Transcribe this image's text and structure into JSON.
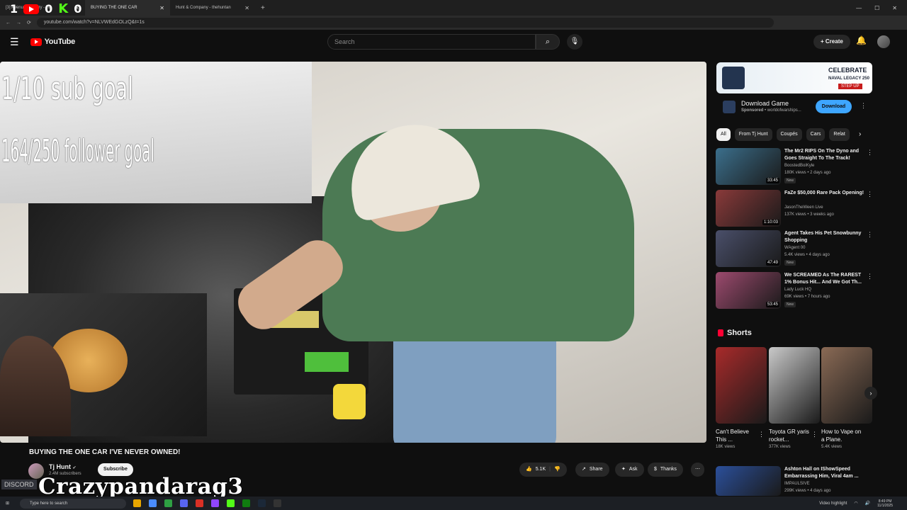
{
  "browser": {
    "tabs": [
      {
        "label": "[3] Avenue | ...tuary - Tw",
        "active": false
      },
      {
        "label": "BUYING THE ONE CAR",
        "active": true
      },
      {
        "label": "Hunt & Company - thehuntan",
        "active": false
      }
    ],
    "url": "youtube.com/watch?v=NLVWEdGOLzQ&t=1s"
  },
  "stream_overlay": {
    "counter_twitch": "1",
    "counter_youtube": "0",
    "counter_kick": "0",
    "kick_glyph": "K",
    "sub_goal": "1/10 sub goal",
    "follower_goal": "164/250 follower goal",
    "username": "Crazypandarag3",
    "discord_label": "DISCORD"
  },
  "header": {
    "logo_text": "YouTube",
    "search_placeholder": "Search",
    "create_label": "Create"
  },
  "video": {
    "title": "BUYING THE ONE CAR I'VE NEVER OWNED!",
    "channel": "Tj Hunt",
    "subscribers": "2.4M subscribers",
    "subscribe_label": "Subscribe",
    "likes": "5.1K",
    "share_label": "Share",
    "ask_label": "Ask",
    "thanks_label": "Thanks"
  },
  "sidebar": {
    "ad": {
      "banner_line1": "CELEBRATE",
      "banner_line2": "NAVAL LEGACY 250",
      "banner_cta": "STEP UP",
      "title": "Download Game",
      "sponsored": "Sponsored",
      "domain": "worldofwarships...",
      "button": "Download"
    },
    "chips": [
      "All",
      "From Tj Hunt",
      "Coupés",
      "Cars",
      "Relat"
    ],
    "recommendations": [
      {
        "title": "The Mr2 RIPS On The Dyno and Goes Straight To The Track!",
        "channel": "BoostedBoiKyle",
        "meta": "180K views • 2 days ago",
        "badge": "New",
        "duration": "33:45",
        "color": "#3b6f8c"
      },
      {
        "title": "FaZe $50,000 Rare Pack Opening!",
        "channel": "JasonTheWeen Live",
        "meta": "137K views • 3 weeks ago",
        "badge": "",
        "duration": "1:10:03",
        "color": "#8a3a3a"
      },
      {
        "title": "Agent Takes His Pet Snowbunny Shopping",
        "channel": "WAgent 00",
        "meta": "5.4K views • 4 days ago",
        "badge": "New",
        "duration": "47:49",
        "color": "#4a4f6a"
      },
      {
        "title": "We SCREAMED As The RAREST 1% Bonus Hit... And We Got Th...",
        "channel": "Lady Luck HQ",
        "meta": "69K views • 7 hours ago",
        "badge": "New",
        "duration": "53:45",
        "color": "#9c4a6e"
      }
    ],
    "shorts_heading": "Shorts",
    "shorts": [
      {
        "title": "Can't Believe This ...",
        "views": "18K views",
        "color": "#a82a2a"
      },
      {
        "title": "Toyota GR yaris rocket...",
        "views": "377K views",
        "color": "#c9c9c9"
      },
      {
        "title": "How to Vape on a Plane.",
        "views": "5.4K views",
        "color": "#8a6a55"
      }
    ],
    "rec_bottom": {
      "title": "Ashton Hall on IShowSpeed Embarrassing Him, Viral 4am ...",
      "channel": "IMPAULSIVE",
      "meta": "299K views • 4 days ago",
      "color": "#2b4f9a"
    }
  },
  "taskbar": {
    "search_placeholder": "Type here to search",
    "video_highlight": "Video highlight",
    "time": "8:49 PM",
    "date": "11/1/2025"
  }
}
